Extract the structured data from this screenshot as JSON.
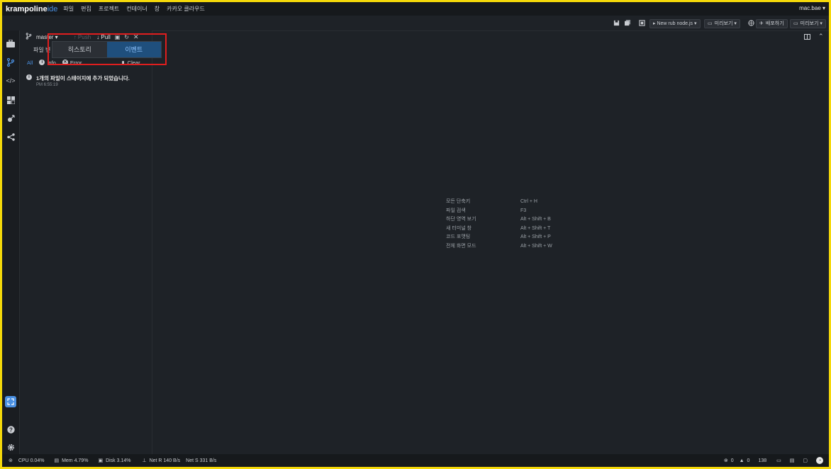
{
  "menubar": {
    "logo_main": "krampoline",
    "logo_ide": "ide",
    "items": [
      "파일",
      "편집",
      "프로젝트",
      "컨테이너",
      "창",
      "카카오 클라우드"
    ],
    "user": "mac.bae ▾"
  },
  "toolbar": {
    "run_label": "▸ New rub node.js ▾",
    "preview1": "미리보기 ▾",
    "deploy": "배포하기",
    "preview2": "미리보기 ▾"
  },
  "git": {
    "branch": "master ▾",
    "push": "Push",
    "pull": "Pull",
    "subrow_label": "파일 변",
    "filters": {
      "all": "All",
      "info": "Info",
      "error": "Error",
      "clear": "Clear"
    },
    "event": {
      "message": "1개의 파일이 스테이지에 추가 되었습니다.",
      "time": "PM 6:55:19"
    }
  },
  "popover": {
    "tabs": [
      "히스토리",
      "이벤트"
    ],
    "active_tab": "이벤트"
  },
  "shortcuts": [
    {
      "name": "모든 단축키",
      "keys": "Ctrl + H"
    },
    {
      "name": "파일 검색",
      "keys": "F3"
    },
    {
      "name": "하단 영역 보기",
      "keys": "Alt + Shift + B"
    },
    {
      "name": "새 터미널 창",
      "keys": "Alt + Shift + T"
    },
    {
      "name": "코드 포맷팅",
      "keys": "Alt + Shift + P"
    },
    {
      "name": "전체 화면 모드",
      "keys": "Alt + Shift + W"
    }
  ],
  "statusbar": {
    "cpu": "CPU 0.04%",
    "mem": "Mem 4.79%",
    "disk": "Disk 3.14%",
    "net_r": "Net R 140 B/s",
    "net_s": "Net S 331 B/s",
    "errors": "0",
    "warnings": "0",
    "misc": "138"
  },
  "colors": {
    "frame": "#f5d90a",
    "highlight": "#e01e1e",
    "accent": "#4a90e2",
    "active_tab_bg": "#1f4f7d"
  }
}
